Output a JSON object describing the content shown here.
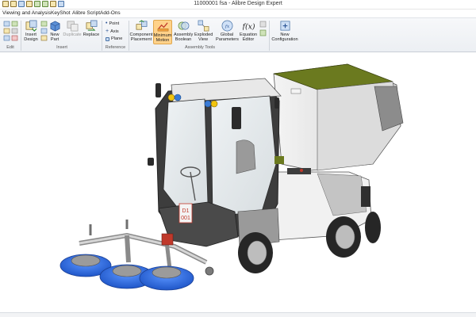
{
  "window": {
    "title": "11000001 fsa - Alibre Design Expert"
  },
  "menu": {
    "items": [
      "Viewing and Analysis",
      "KeyShot",
      "Alibre Script",
      "Add-Ons"
    ]
  },
  "ribbon": {
    "groups": {
      "edit": "Edit",
      "insert": "Insert",
      "reference": "Reference",
      "assembly_tools": "Assembly Tools"
    },
    "buttons": {
      "insert_design": "Insert Design",
      "new_part": "New Part",
      "duplicate": "Duplicate",
      "replace": "Replace",
      "point": "Point",
      "axis": "Axis",
      "plane": "Plane",
      "component_placement": "Component Placement",
      "minimum_motion": "Minimum Motion",
      "assembly_boolean": "Assembly Boolean",
      "exploded_view": "Exploded View",
      "global_parameters": "Global Parameters",
      "equation_editor": "Equation Editor",
      "new_configuration": "New Configuration"
    }
  },
  "model": {
    "id_plate_line1": "D1",
    "id_plate_line2": "001"
  },
  "colors": {
    "ribbon_bg": "#eceff3",
    "active_button": "#ffd28a",
    "brush_blue": "#2f6fe0",
    "hopper_lid": "#6b7a1f",
    "frame_dark": "#3d3d3d",
    "body_light": "#e6e6e6"
  },
  "icons": {
    "insert_design": "insert-design-icon",
    "new_part": "new-part-icon",
    "minimum_motion": "minimum-motion-icon",
    "equation_editor": "fx-icon",
    "global_parameters": "global-parameters-icon"
  }
}
